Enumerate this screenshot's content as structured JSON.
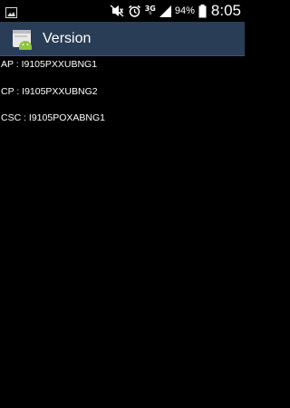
{
  "status_bar": {
    "left_icon": "image-notification-icon",
    "icons": [
      "mute-icon",
      "alarm-icon",
      "mobile-data-icon",
      "signal-icon",
      "battery-icon"
    ],
    "network_type": "3G",
    "battery_percent": "94%",
    "time": "8:05"
  },
  "action_bar": {
    "app_icon": "android-settings-app-icon",
    "title": "Version",
    "background_color": "#2a3d57"
  },
  "versions": [
    {
      "label": "AP",
      "value": "I9105PXXUBNG1",
      "text": "AP : I9105PXXUBNG1"
    },
    {
      "label": "CP",
      "value": "I9105PXXUBNG2",
      "text": "CP : I9105PXXUBNG2"
    },
    {
      "label": "CSC",
      "value": "I9105POXABNG1",
      "text": "CSC : I9105POXABNG1"
    }
  ]
}
